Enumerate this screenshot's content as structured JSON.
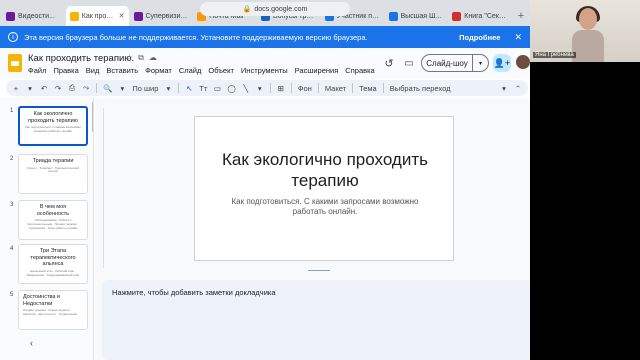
{
  "browser": {
    "url": "docs.google.com",
    "tabs": [
      {
        "label": "Видеости...",
        "color": "#6a1b9a",
        "active": false
      },
      {
        "label": "Как проходи...",
        "color": "#f4b400",
        "active": true
      },
      {
        "label": "Супервизия...",
        "color": "#6a1b9a",
        "active": false
      },
      {
        "label": "Почта Mail",
        "color": "#ff9800",
        "active": false
      },
      {
        "label": "Бонусы трав...",
        "color": "#1565c0",
        "active": false
      },
      {
        "label": "Участник пу...",
        "color": "#1a73e8",
        "active": false
      },
      {
        "label": "Высшая Ш...",
        "color": "#1a73e8",
        "active": false
      },
      {
        "label": "Книга \"Сексо...",
        "color": "#d32f2f",
        "active": false
      }
    ],
    "new_tab": "+"
  },
  "warning": {
    "text": "Эта версия браузера больше не поддерживается. Установите поддерживаемую версию браузера.",
    "more": "Подробнее",
    "close": "✕",
    "info_icon": "i"
  },
  "header": {
    "title": "Как проходить терапию.",
    "title_icons": [
      "☆",
      "⧉",
      "☁"
    ],
    "menus": [
      "Файл",
      "Правка",
      "Вид",
      "Вставить",
      "Формат",
      "Слайд",
      "Объект",
      "Инструменты",
      "Расширения",
      "Справка"
    ],
    "slideshow": "Слайд-шоу",
    "slideshow_caret": "▾",
    "history_icon": "↺",
    "chat_icon": "▭",
    "share_icon": "👤+"
  },
  "toolbar": {
    "items": [
      "+",
      "▾",
      "↶",
      "↷",
      "⎙",
      "⤳",
      "🔍",
      "▾",
      "По шир",
      "▾",
      "↖",
      "Tт",
      "▭",
      "◯",
      "╲",
      "▾",
      "⊞",
      "Фон",
      "Макет",
      "Тема",
      "Выбрать переход",
      "▾",
      "⌃"
    ]
  },
  "filmstrip": {
    "slides": [
      {
        "num": "1",
        "title": "Как экологично проходить терапию",
        "body": "Как подготовиться. С какими запросами возможно работать онлайн",
        "selected": true,
        "align": "center"
      },
      {
        "num": "2",
        "title": "Триада терапии",
        "body": "Клиент · Терапевт · Терапевтический альянс",
        "selected": false,
        "align": "center"
      },
      {
        "num": "3",
        "title": "В чем моя особенность",
        "body": "Психодинамика · Работа с бессознательным · Личная терапия · Супервизия · Опыт работы онлайн",
        "selected": false,
        "align": "center"
      },
      {
        "num": "4",
        "title": "Три Этапа терапевтического альянса",
        "body": "Начальный этап · Рабочий этап · Завершение · Поддерживающий этап",
        "selected": false,
        "align": "center"
      },
      {
        "num": "5",
        "title": "Достоинства и Недостатки",
        "body": "Онлайн терапия · Очная терапия · Удобство · Доступность · Ограничения",
        "selected": false,
        "align": "left"
      }
    ],
    "collapse_icon": "‹"
  },
  "slide": {
    "title": "Как экологично проходить терапию",
    "subtitle": "Как подготовиться. С какими запросами возможно работать онлайн."
  },
  "notes": {
    "placeholder": "Нажмите, чтобы добавить заметки докладчика"
  },
  "webcam": {
    "name": "Яна Гребнева"
  }
}
